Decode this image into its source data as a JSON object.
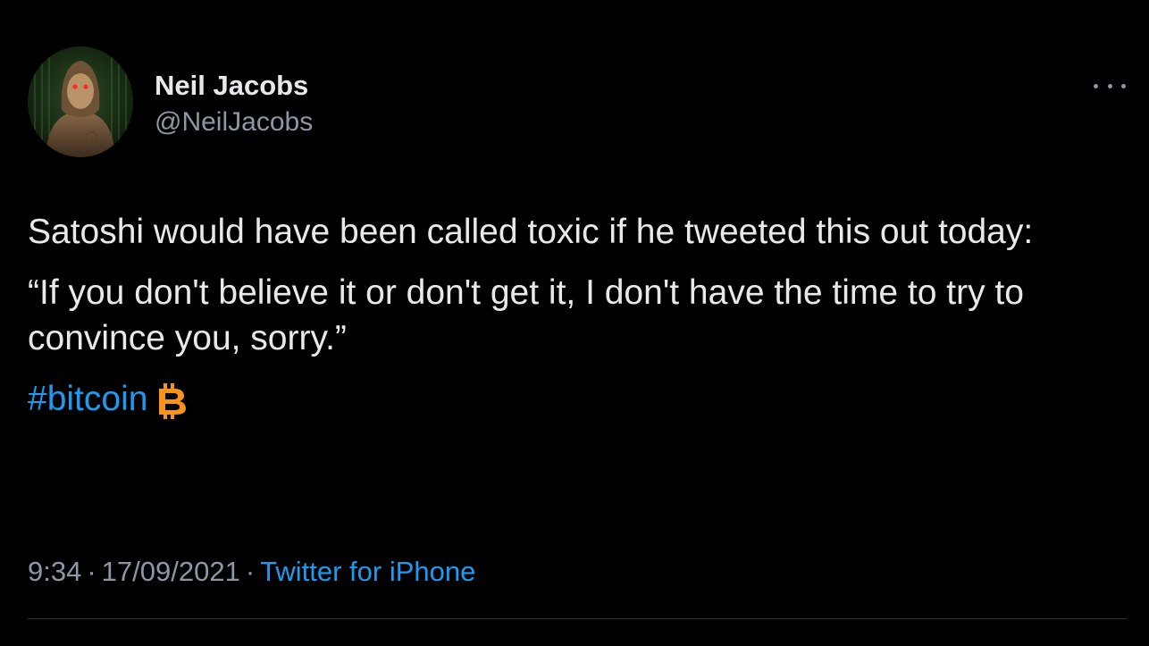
{
  "author": {
    "display_name": "Neil Jacobs",
    "handle": "@NeilJacobs",
    "avatar_icon": "hooded-figure-avatar"
  },
  "tweet": {
    "paragraph_1": "Satoshi would have been called toxic if he tweeted this out today:",
    "paragraph_2": "“If you don't believe it or don't get it, I don't have the time to try to convince you, sorry.”",
    "hashtag": "#bitcoin",
    "hashtag_emoji_icon": "bitcoin-icon"
  },
  "meta": {
    "time": "9:34",
    "separator": "·",
    "date": "17/09/2021",
    "source": "Twitter for iPhone"
  },
  "colors": {
    "background": "#000000",
    "text_primary": "#e7e9ea",
    "text_secondary": "#8b98a5",
    "link": "#1d9bf0",
    "bitcoin_orange": "#f7931a",
    "divider": "#2f3336"
  }
}
